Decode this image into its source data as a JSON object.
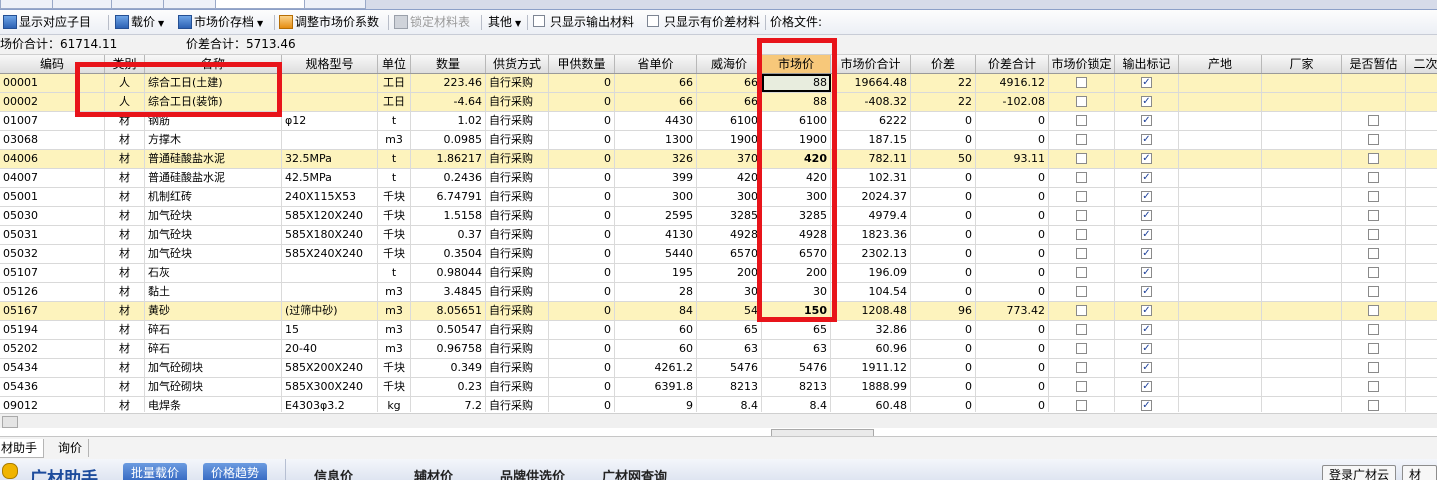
{
  "toolbar": {
    "show_sub": "显示对应子目",
    "load_price": "载价",
    "save_market": "市场价存档",
    "adjust_coef": "调整市场价系数",
    "lock_table": "锁定材料表",
    "other": "其他",
    "only_output": "只显示输出材料",
    "only_diff": "只显示有价差材料",
    "price_file": "价格文件:"
  },
  "summary": {
    "market_total": "场价合计：61714.11",
    "diff_total": "价差合计：5713.46"
  },
  "columns": [
    "编码",
    "类别",
    "名称",
    "规格型号",
    "单位",
    "数量",
    "供货方式",
    "甲供数量",
    "省单价",
    "威海价",
    "市场价",
    "市场价合计",
    "价差",
    "价差合计",
    "市场价锁定",
    "输出标记",
    "产地",
    "厂家",
    "是否暂估",
    "二次"
  ],
  "rows": [
    {
      "code": "00001",
      "type": "人",
      "name": "综合工日(土建)",
      "spec": "",
      "unit": "工日",
      "qty": "223.46",
      "supply": "自行采购",
      "jia": "0",
      "prov": "66",
      "weihai": "66",
      "market": "88",
      "total": "19664.48",
      "diff": "22",
      "diffsum": "4916.12",
      "lock": false,
      "out": true,
      "zangu": false
    },
    {
      "code": "00002",
      "type": "人",
      "name": "综合工日(装饰)",
      "spec": "",
      "unit": "工日",
      "qty": "-4.64",
      "supply": "自行采购",
      "jia": "0",
      "prov": "66",
      "weihai": "66",
      "market": "88",
      "total": "-408.32",
      "diff": "22",
      "diffsum": "-102.08",
      "lock": false,
      "out": true,
      "zangu": false
    },
    {
      "code": "01007",
      "type": "材",
      "name": "钢筋",
      "spec": "φ12",
      "unit": "t",
      "qty": "1.02",
      "supply": "自行采购",
      "jia": "0",
      "prov": "4430",
      "weihai": "6100",
      "market": "6100",
      "total": "6222",
      "diff": "0",
      "diffsum": "0",
      "lock": false,
      "out": true,
      "zangu": false
    },
    {
      "code": "03068",
      "type": "材",
      "name": "方撑木",
      "spec": "",
      "unit": "m3",
      "qty": "0.0985",
      "supply": "自行采购",
      "jia": "0",
      "prov": "1300",
      "weihai": "1900",
      "market": "1900",
      "total": "187.15",
      "diff": "0",
      "diffsum": "0",
      "lock": false,
      "out": true,
      "zangu": false
    },
    {
      "code": "04006",
      "type": "材",
      "name": "普通硅酸盐水泥",
      "spec": "32.5MPa",
      "unit": "t",
      "qty": "1.86217",
      "supply": "自行采购",
      "jia": "0",
      "prov": "326",
      "weihai": "370",
      "market": "420",
      "total": "782.11",
      "diff": "50",
      "diffsum": "93.11",
      "lock": false,
      "out": true,
      "zangu": false
    },
    {
      "code": "04007",
      "type": "材",
      "name": "普通硅酸盐水泥",
      "spec": "42.5MPa",
      "unit": "t",
      "qty": "0.2436",
      "supply": "自行采购",
      "jia": "0",
      "prov": "399",
      "weihai": "420",
      "market": "420",
      "total": "102.31",
      "diff": "0",
      "diffsum": "0",
      "lock": false,
      "out": true,
      "zangu": false
    },
    {
      "code": "05001",
      "type": "材",
      "name": "机制红砖",
      "spec": "240X115X53",
      "unit": "千块",
      "qty": "6.74791",
      "supply": "自行采购",
      "jia": "0",
      "prov": "300",
      "weihai": "300",
      "market": "300",
      "total": "2024.37",
      "diff": "0",
      "diffsum": "0",
      "lock": false,
      "out": true,
      "zangu": false
    },
    {
      "code": "05030",
      "type": "材",
      "name": "加气砼块",
      "spec": "585X120X240",
      "unit": "千块",
      "qty": "1.5158",
      "supply": "自行采购",
      "jia": "0",
      "prov": "2595",
      "weihai": "3285",
      "market": "3285",
      "total": "4979.4",
      "diff": "0",
      "diffsum": "0",
      "lock": false,
      "out": true,
      "zangu": false
    },
    {
      "code": "05031",
      "type": "材",
      "name": "加气砼块",
      "spec": "585X180X240",
      "unit": "千块",
      "qty": "0.37",
      "supply": "自行采购",
      "jia": "0",
      "prov": "4130",
      "weihai": "4928",
      "market": "4928",
      "total": "1823.36",
      "diff": "0",
      "diffsum": "0",
      "lock": false,
      "out": true,
      "zangu": false
    },
    {
      "code": "05032",
      "type": "材",
      "name": "加气砼块",
      "spec": "585X240X240",
      "unit": "千块",
      "qty": "0.3504",
      "supply": "自行采购",
      "jia": "0",
      "prov": "5440",
      "weihai": "6570",
      "market": "6570",
      "total": "2302.13",
      "diff": "0",
      "diffsum": "0",
      "lock": false,
      "out": true,
      "zangu": false
    },
    {
      "code": "05107",
      "type": "材",
      "name": "石灰",
      "spec": "",
      "unit": "t",
      "qty": "0.98044",
      "supply": "自行采购",
      "jia": "0",
      "prov": "195",
      "weihai": "200",
      "market": "200",
      "total": "196.09",
      "diff": "0",
      "diffsum": "0",
      "lock": false,
      "out": true,
      "zangu": false
    },
    {
      "code": "05126",
      "type": "材",
      "name": "黏土",
      "spec": "",
      "unit": "m3",
      "qty": "3.4845",
      "supply": "自行采购",
      "jia": "0",
      "prov": "28",
      "weihai": "30",
      "market": "30",
      "total": "104.54",
      "diff": "0",
      "diffsum": "0",
      "lock": false,
      "out": true,
      "zangu": false
    },
    {
      "code": "05167",
      "type": "材",
      "name": "黄砂",
      "spec": "(过筛中砂)",
      "unit": "m3",
      "qty": "8.05651",
      "supply": "自行采购",
      "jia": "0",
      "prov": "84",
      "weihai": "54",
      "market": "150",
      "total": "1208.48",
      "diff": "96",
      "diffsum": "773.42",
      "lock": false,
      "out": true,
      "zangu": false
    },
    {
      "code": "05194",
      "type": "材",
      "name": "碎石",
      "spec": "15",
      "unit": "m3",
      "qty": "0.50547",
      "supply": "自行采购",
      "jia": "0",
      "prov": "60",
      "weihai": "65",
      "market": "65",
      "total": "32.86",
      "diff": "0",
      "diffsum": "0",
      "lock": false,
      "out": true,
      "zangu": false
    },
    {
      "code": "05202",
      "type": "材",
      "name": "碎石",
      "spec": "20-40",
      "unit": "m3",
      "qty": "0.96758",
      "supply": "自行采购",
      "jia": "0",
      "prov": "60",
      "weihai": "63",
      "market": "63",
      "total": "60.96",
      "diff": "0",
      "diffsum": "0",
      "lock": false,
      "out": true,
      "zangu": false
    },
    {
      "code": "05434",
      "type": "材",
      "name": "加气砼砌块",
      "spec": "585X200X240",
      "unit": "千块",
      "qty": "0.349",
      "supply": "自行采购",
      "jia": "0",
      "prov": "4261.2",
      "weihai": "5476",
      "market": "5476",
      "total": "1911.12",
      "diff": "0",
      "diffsum": "0",
      "lock": false,
      "out": true,
      "zangu": false
    },
    {
      "code": "05436",
      "type": "材",
      "name": "加气砼砌块",
      "spec": "585X300X240",
      "unit": "千块",
      "qty": "0.23",
      "supply": "自行采购",
      "jia": "0",
      "prov": "6391.8",
      "weihai": "8213",
      "market": "8213",
      "total": "1888.99",
      "diff": "0",
      "diffsum": "0",
      "lock": false,
      "out": true,
      "zangu": false
    },
    {
      "code": "09012",
      "type": "材",
      "name": "电焊条",
      "spec": "E4303φ3.2",
      "unit": "kg",
      "qty": "7.2",
      "supply": "自行采购",
      "jia": "0",
      "prov": "9",
      "weihai": "8.4",
      "market": "8.4",
      "total": "60.48",
      "diff": "0",
      "diffsum": "0",
      "lock": false,
      "out": true,
      "zangu": false
    }
  ],
  "bottom_tabs": [
    "材助手",
    "询价"
  ],
  "helper": {
    "title": "广材助手",
    "batch_load": "批量载价",
    "price_trend": "价格趋势",
    "info_price": "信息价",
    "special_price": "辅材价",
    "brand_price": "品牌供选价",
    "guangcai_query": "广材网查询",
    "login": "登录广材云",
    "material_btn": "材料"
  },
  "colors": {
    "highlight_row": "#fdf3bd",
    "active_header": "#f7c87a",
    "red_box": "#e8141a"
  }
}
